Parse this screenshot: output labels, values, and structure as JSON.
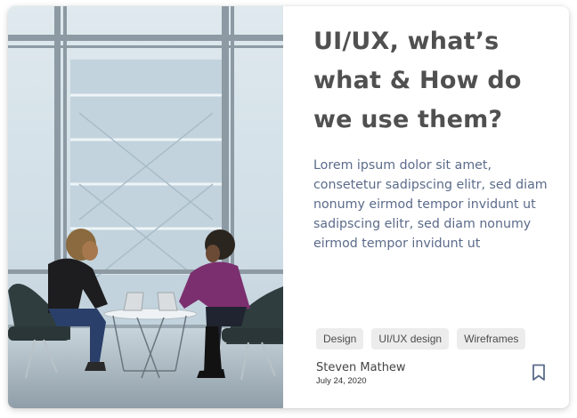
{
  "card": {
    "image_icon": "photo-two-women-working-on-laptops",
    "title": "UI/UX, what’s what & How do we use them?",
    "description": "Lorem ipsum dolor sit amet, consetetur sadipscing elitr, sed diam nonumy eirmod tempor invidunt ut sadipscing elitr, sed diam nonumy eirmod tempor invidunt ut",
    "tags": [
      "Design",
      "UI/UX design",
      "Wireframes"
    ],
    "author": "Steven Mathew",
    "date": "July 24, 2020",
    "bookmark_icon": "bookmark-icon"
  },
  "colors": {
    "title": "#505050",
    "description": "#5b6b8a",
    "tag_background": "#ececec",
    "bookmark": "#5b6b8a"
  }
}
